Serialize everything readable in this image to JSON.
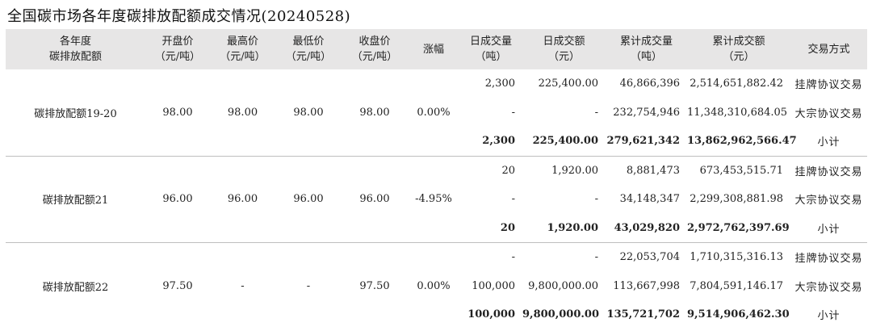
{
  "title": "全国碳市场各年度碳排放配额成交情况(20240528)",
  "headers": [
    [
      "各年度",
      "碳排放配额"
    ],
    [
      "开盘价",
      "（元/吨）"
    ],
    [
      "最高价",
      "（元/吨）"
    ],
    [
      "最低价",
      "（元/吨）"
    ],
    [
      "收盘价",
      "（元/吨）"
    ],
    [
      "涨幅"
    ],
    [
      "日成交量",
      "（吨）"
    ],
    [
      "日成交额",
      "（元）"
    ],
    [
      "累计成交量",
      "（吨）"
    ],
    [
      "累计成交额",
      "（元）"
    ],
    [
      "交易方式"
    ]
  ],
  "groups": [
    {
      "name": "碳排放配额19-20",
      "open": "98.00",
      "high": "98.00",
      "low": "98.00",
      "close": "98.00",
      "change": "0.00%",
      "rows": [
        {
          "vol": "2,300",
          "amt": "225,400.00",
          "cum_vol": "46,866,396",
          "cum_amt": "2,514,651,882.42",
          "method": "挂牌协议交易"
        },
        {
          "vol": "-",
          "amt": "-",
          "cum_vol": "232,754,946",
          "cum_amt": "11,348,310,684.05",
          "method": "大宗协议交易"
        },
        {
          "vol": "2,300",
          "amt": "225,400.00",
          "cum_vol": "279,621,342",
          "cum_amt": "13,862,962,566.47",
          "method": "小计"
        }
      ]
    },
    {
      "name": "碳排放配额21",
      "open": "96.00",
      "high": "96.00",
      "low": "96.00",
      "close": "96.00",
      "change": "-4.95%",
      "rows": [
        {
          "vol": "20",
          "amt": "1,920.00",
          "cum_vol": "8,881,473",
          "cum_amt": "673,453,515.71",
          "method": "挂牌协议交易"
        },
        {
          "vol": "-",
          "amt": "-",
          "cum_vol": "34,148,347",
          "cum_amt": "2,299,308,881.98",
          "method": "大宗协议交易"
        },
        {
          "vol": "20",
          "amt": "1,920.00",
          "cum_vol": "43,029,820",
          "cum_amt": "2,972,762,397.69",
          "method": "小计"
        }
      ]
    },
    {
      "name": "碳排放配额22",
      "open": "97.50",
      "high": "-",
      "low": "-",
      "close": "97.50",
      "change": "0.00%",
      "rows": [
        {
          "vol": "-",
          "amt": "-",
          "cum_vol": "22,053,704",
          "cum_amt": "1,710,315,316.13",
          "method": "挂牌协议交易"
        },
        {
          "vol": "100,000",
          "amt": "9,800,000.00",
          "cum_vol": "113,667,998",
          "cum_amt": "7,804,591,146.17",
          "method": "大宗协议交易"
        },
        {
          "vol": "100,000",
          "amt": "9,800,000.00",
          "cum_vol": "135,721,702",
          "cum_amt": "9,514,906,462.30",
          "method": "小计"
        }
      ]
    }
  ]
}
